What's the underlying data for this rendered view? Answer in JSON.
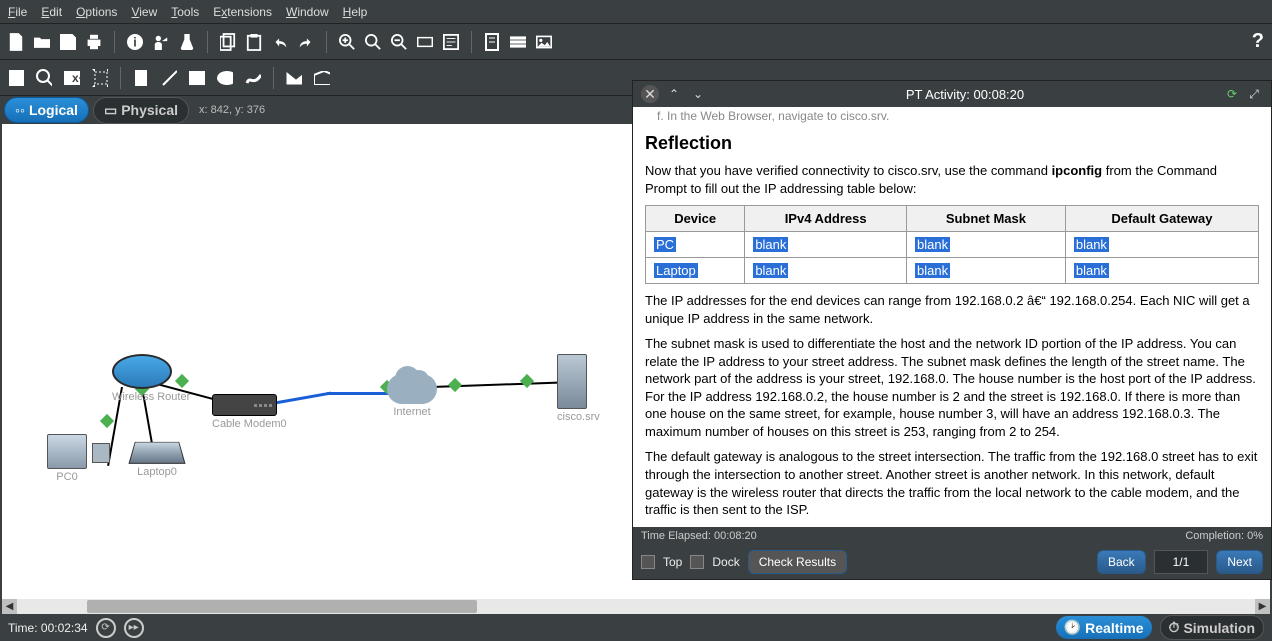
{
  "menu": {
    "file": "File",
    "edit": "Edit",
    "options": "Options",
    "view": "View",
    "tools": "Tools",
    "extensions": "Extensions",
    "window": "Window",
    "help": "Help"
  },
  "view_tabs": {
    "logical": "Logical",
    "physical": "Physical"
  },
  "coords": "x: 842, y: 376",
  "devices": {
    "router": "Wireless Router",
    "modem": "Cable Modem0",
    "cloud": "Internet",
    "server": "cisco.srv",
    "pc": "PC0",
    "laptop": "Laptop0"
  },
  "activity": {
    "title": "PT Activity: 00:08:20",
    "truncated": "f.   In the Web Browser, navigate to cisco.srv.",
    "h2": "Reflection",
    "intro1": "Now that you have verified connectivity to cisco.srv, use the command ",
    "intro_cmd": "ipconfig",
    "intro2": " from the Command Prompt to fill out the IP addressing table below:",
    "th_device": "Device",
    "th_ipv4": "IPv4 Address",
    "th_mask": "Subnet Mask",
    "th_gw": "Default Gateway",
    "row_pc": "PC",
    "row_laptop": "Laptop",
    "blank": "blank",
    "p1": "The IP addresses for the end devices can range from 192.168.0.2 â€“ 192.168.0.254. Each NIC will get a unique IP address in the same network.",
    "p2": "The subnet mask is used to differentiate the host and the network ID portion of the IP address. You can relate the IP address to your street address. The subnet mask defines the length of the street name. The network part of the address is your street, 192.168.0. The house number is the host port of the IP address. For the IP address 192.168.0.2, the house number is 2 and the street is 192.168.0. If there is more than one house on the same street, for example, house number 3, will have an address 192.168.0.3. The maximum number of houses on this street is 253, ranging from 2 to 254.",
    "p3": "The default gateway is analogous to the street intersection. The traffic from the 192.168.0 street has to exit through the intersection to another street. Another street is another network. In this network, default gateway is the wireless router that directs the traffic from the local network to the cable modem, and the traffic is then sent to the ISP.",
    "time_elapsed": "Time Elapsed: 00:08:20",
    "completion": "Completion: 0%",
    "top": "Top",
    "dock": "Dock",
    "check": "Check Results",
    "back": "Back",
    "page": "1/1",
    "next": "Next"
  },
  "status": {
    "time": "Time: 00:02:34",
    "realtime": "Realtime",
    "simulation": "Simulation"
  }
}
